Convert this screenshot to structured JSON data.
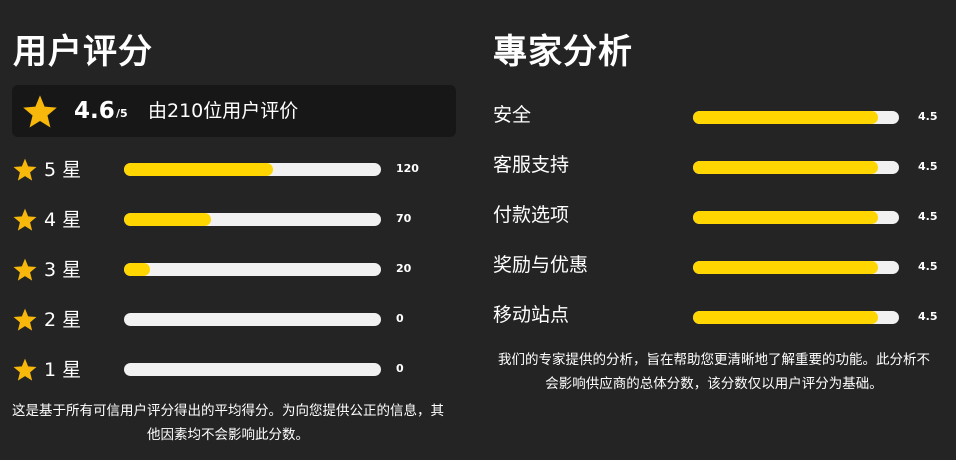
{
  "user_ratings": {
    "title": "用户评分",
    "summary": {
      "score": "4.6",
      "out_of": "/5",
      "count_text": "由210位用户评价"
    },
    "rows": [
      {
        "label": "5 星",
        "count": "120",
        "fill": 0.58
      },
      {
        "label": "4 星",
        "count": "70",
        "fill": 0.34
      },
      {
        "label": "3 星",
        "count": "20",
        "fill": 0.1
      },
      {
        "label": "2 星",
        "count": "0",
        "fill": 0.0
      },
      {
        "label": "1 星",
        "count": "0",
        "fill": 0.0
      }
    ],
    "note": "这是基于所有可信用户评分得出的平均得分。为向您提供公正的信息，其他因素均不会影响此分数。"
  },
  "expert_analysis": {
    "title": "專家分析",
    "categories": [
      {
        "label": "安全",
        "score": "4.5",
        "fill": 0.9
      },
      {
        "label": "客服支持",
        "score": "4.5",
        "fill": 0.9
      },
      {
        "label": "付款选项",
        "score": "4.5",
        "fill": 0.9
      },
      {
        "label": "奖励与优惠",
        "score": "4.5",
        "fill": 0.9
      },
      {
        "label": "移动站点",
        "score": "4.5",
        "fill": 0.9
      }
    ],
    "note": "我们的专家提供的分析，旨在帮助您更清晰地了解重要的功能。此分析不会影响供应商的总体分数，该分数仅以用户评分为基础。"
  },
  "colors": {
    "background": "#242424",
    "summary_box": "#171717",
    "accent": "#ffd600",
    "star": "#f7b80b",
    "track": "#f1f1f1"
  },
  "icons": {
    "star": "star-icon"
  }
}
